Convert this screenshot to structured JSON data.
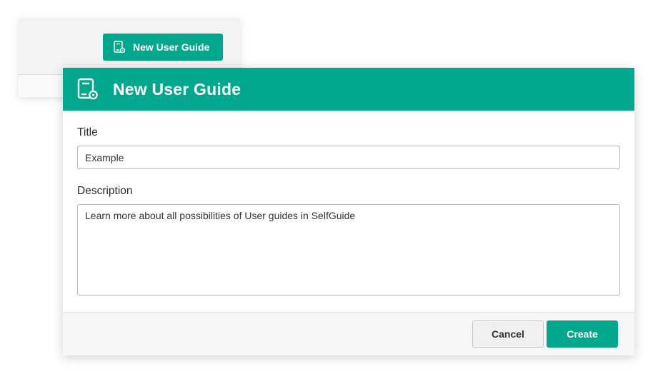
{
  "colors": {
    "accent": "#00a78d",
    "header_text": "#ffffff"
  },
  "background_panel": {
    "button_label": "New User Guide",
    "button_icon": "user-guide-icon"
  },
  "dialog": {
    "title": "New User Guide",
    "title_icon": "user-guide-icon",
    "fields": {
      "title_label": "Title",
      "title_value": "Example",
      "description_label": "Description",
      "description_value": "Learn more about all possibilities of User guides in SelfGuide"
    },
    "footer": {
      "cancel_label": "Cancel",
      "create_label": "Create"
    }
  }
}
